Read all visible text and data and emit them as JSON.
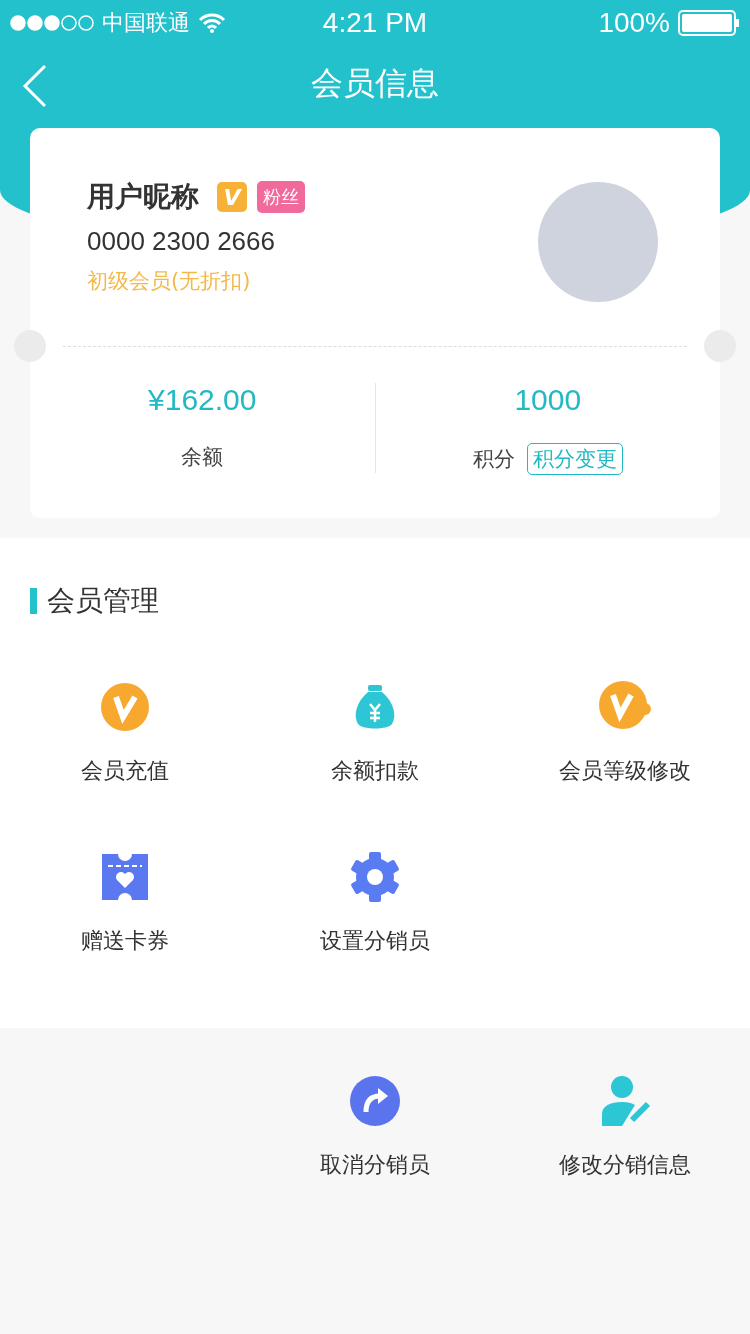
{
  "status_bar": {
    "carrier": "中国联通",
    "time": "4:21 PM",
    "battery": "100%"
  },
  "nav": {
    "title": "会员信息"
  },
  "member": {
    "nickname": "用户昵称",
    "vip_badge": "V",
    "tag": "粉丝",
    "card_number": "0000 2300 2666",
    "level": "初级会员(无折扣)"
  },
  "stats": [
    {
      "value": "¥162.00",
      "label": "余额"
    },
    {
      "value": "1000",
      "label": "积分",
      "action": "积分变更"
    }
  ],
  "section": {
    "title": "会员管理",
    "items": [
      {
        "kind": "vip",
        "label": "会员充值"
      },
      {
        "kind": "moneybag",
        "label": "余额扣款"
      },
      {
        "kind": "vip-wrench",
        "label": "会员等级修改"
      },
      {
        "kind": "ticket",
        "label": "赠送卡券"
      },
      {
        "kind": "gear",
        "label": "设置分销员"
      }
    ]
  },
  "extra_items": [
    {
      "kind": "share",
      "label": "取消分销员"
    },
    {
      "kind": "person-edit",
      "label": "修改分销信息"
    }
  ]
}
